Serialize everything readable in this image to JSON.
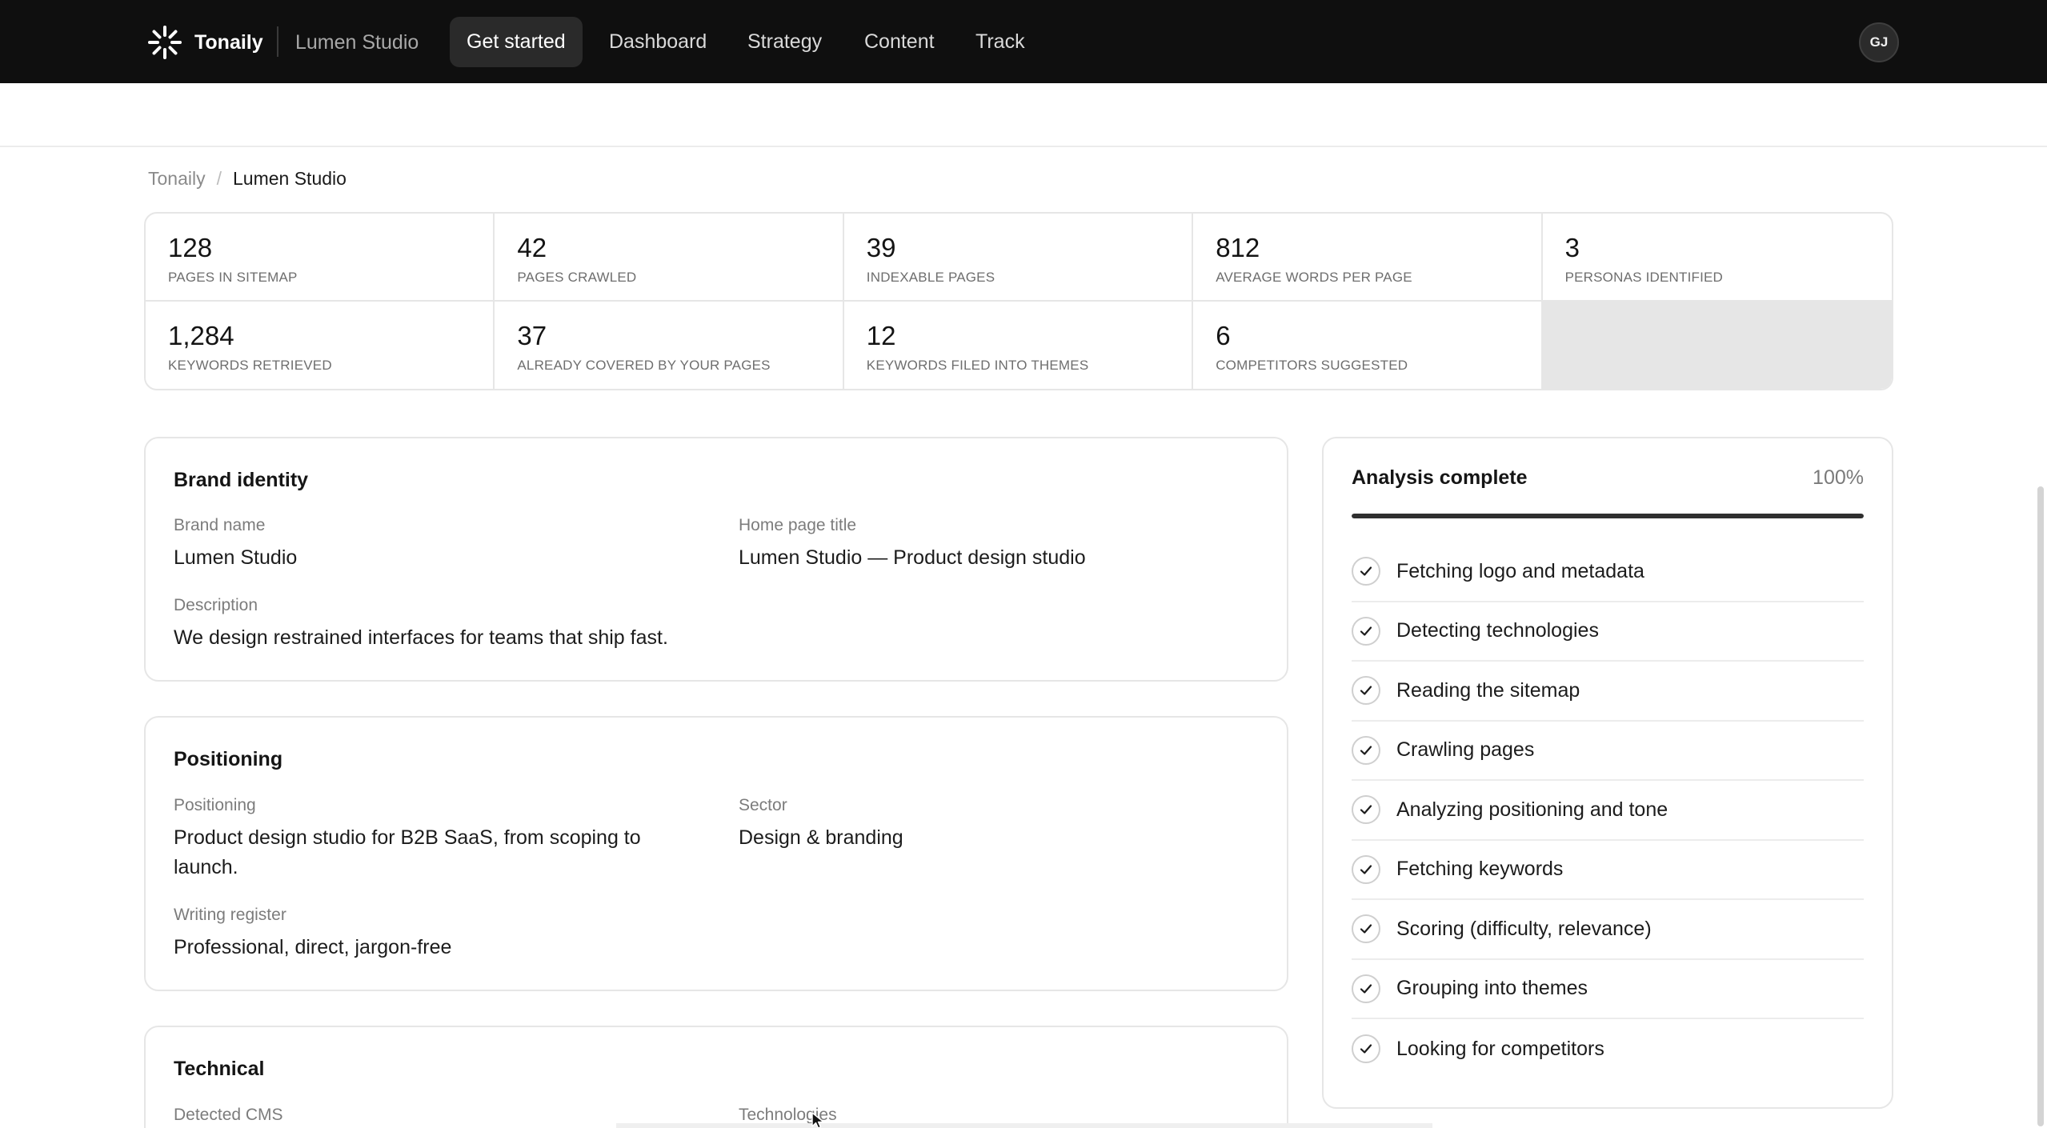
{
  "app": {
    "brand": "Tonaily",
    "project": "Lumen Studio",
    "user_initials": "GJ"
  },
  "nav": {
    "items": [
      {
        "label": "Get started",
        "active": true
      },
      {
        "label": "Dashboard",
        "active": false
      },
      {
        "label": "Strategy",
        "active": false
      },
      {
        "label": "Content",
        "active": false
      },
      {
        "label": "Track",
        "active": false
      }
    ]
  },
  "breadcrumb": {
    "parent": "Tonaily",
    "separator": "/",
    "current": "Lumen Studio"
  },
  "stats": [
    {
      "value": "128",
      "label": "PAGES IN SITEMAP"
    },
    {
      "value": "42",
      "label": "PAGES CRAWLED"
    },
    {
      "value": "39",
      "label": "INDEXABLE PAGES"
    },
    {
      "value": "812",
      "label": "AVERAGE WORDS PER PAGE"
    },
    {
      "value": "3",
      "label": "PERSONAS IDENTIFIED"
    },
    {
      "value": "1,284",
      "label": "KEYWORDS RETRIEVED"
    },
    {
      "value": "37",
      "label": "ALREADY COVERED BY YOUR PAGES"
    },
    {
      "value": "12",
      "label": "KEYWORDS FILED INTO THEMES"
    },
    {
      "value": "6",
      "label": "COMPETITORS SUGGESTED"
    }
  ],
  "brand_identity": {
    "title": "Brand identity",
    "brand_name_label": "Brand name",
    "brand_name": "Lumen Studio",
    "home_title_label": "Home page title",
    "home_title": "Lumen Studio — Product design studio",
    "description_label": "Description",
    "description": "We design restrained interfaces for teams that ship fast."
  },
  "positioning": {
    "title": "Positioning",
    "positioning_label": "Positioning",
    "positioning_line1": "Product design studio for B2B SaaS, from scoping to",
    "positioning_line2": "launch.",
    "sector_label": "Sector",
    "sector": "Design & branding",
    "register_label": "Writing register",
    "register": "Professional, direct, jargon-free"
  },
  "technical": {
    "title": "Technical",
    "cms_label": "Detected CMS",
    "tech_label": "Technologies"
  },
  "analysis": {
    "title": "Analysis complete",
    "percent_label": "100%",
    "progress": 1.0,
    "steps": [
      {
        "label": "Fetching logo and metadata",
        "done": true
      },
      {
        "label": "Detecting technologies",
        "done": true
      },
      {
        "label": "Reading the sitemap",
        "done": true
      },
      {
        "label": "Crawling pages",
        "done": true
      },
      {
        "label": "Analyzing positioning and tone",
        "done": true
      },
      {
        "label": "Fetching keywords",
        "done": true
      },
      {
        "label": "Scoring (difficulty, relevance)",
        "done": true
      },
      {
        "label": "Grouping into themes",
        "done": true
      },
      {
        "label": "Looking for competitors",
        "done": true
      }
    ]
  },
  "icons": {
    "logo": "sparkle-logo-icon",
    "check": "check-icon",
    "cursor": "mouse-pointer-icon"
  }
}
